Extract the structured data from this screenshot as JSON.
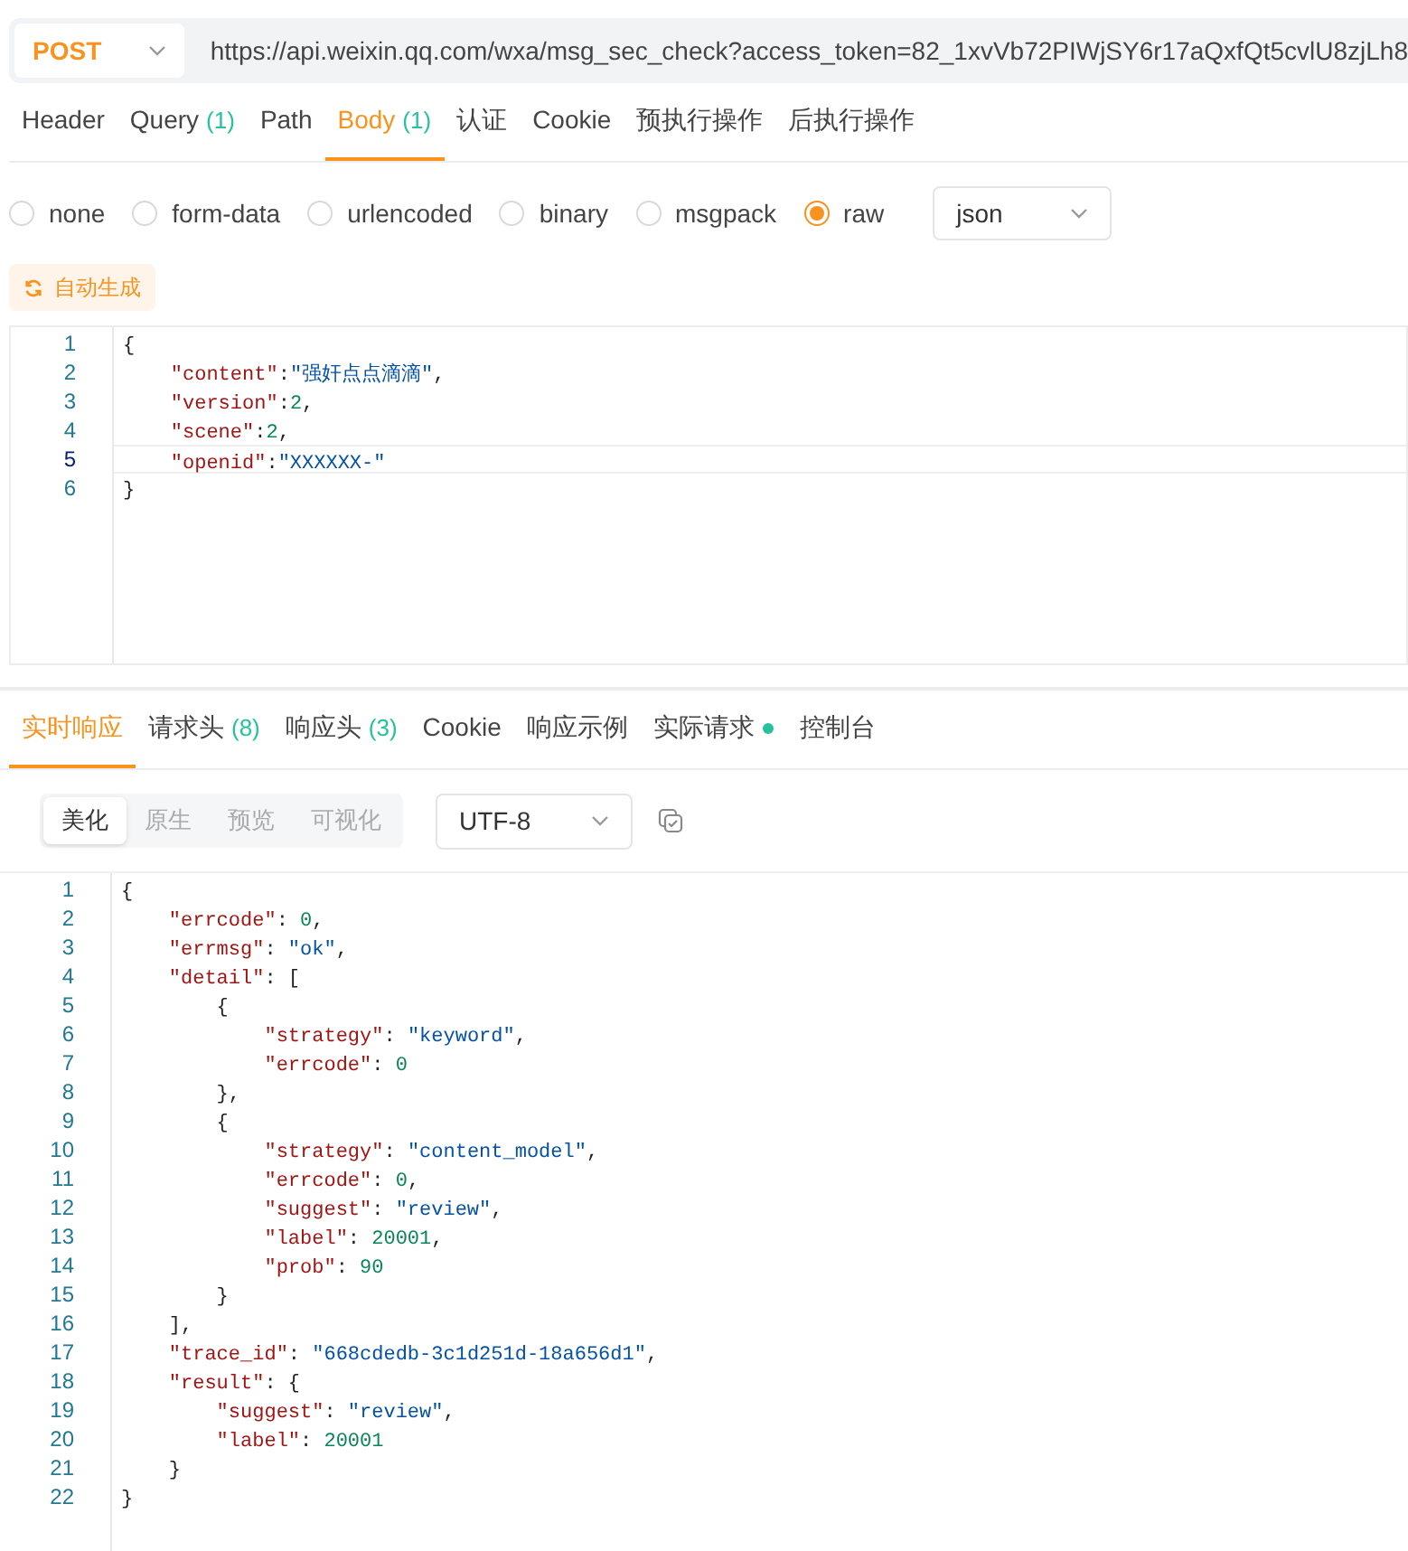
{
  "request": {
    "method": "POST",
    "url": "https://api.weixin.qq.com/wxa/msg_sec_check?access_token=82_1xvVb72PIWjSY6r17aQxfQt5cvlU8zjLh8"
  },
  "request_tabs": [
    {
      "label": "Header",
      "selected": false
    },
    {
      "label": "Query",
      "count": "(1)",
      "selected": false
    },
    {
      "label": "Path",
      "selected": false
    },
    {
      "label": "Body",
      "count": "(1)",
      "selected": true
    },
    {
      "label": "认证",
      "selected": false
    },
    {
      "label": "Cookie",
      "selected": false
    },
    {
      "label": "预执行操作",
      "selected": false
    },
    {
      "label": "后执行操作",
      "selected": false
    }
  ],
  "body_types": [
    {
      "label": "none",
      "selected": false
    },
    {
      "label": "form-data",
      "selected": false
    },
    {
      "label": "urlencoded",
      "selected": false
    },
    {
      "label": "binary",
      "selected": false
    },
    {
      "label": "msgpack",
      "selected": false
    },
    {
      "label": "raw",
      "selected": true
    }
  ],
  "format_select": {
    "value": "json"
  },
  "generate_button": {
    "label": "自动生成"
  },
  "request_body": [
    {
      "number": "1",
      "current": false,
      "tokens": [
        {
          "kind": "p",
          "text": "{"
        }
      ]
    },
    {
      "number": "2",
      "current": false,
      "tokens": [
        {
          "kind": "k",
          "text": "    \"content\""
        },
        {
          "kind": "p",
          "text": ":"
        },
        {
          "kind": "s",
          "text": "\"强奸点点滴滴\""
        },
        {
          "kind": "p",
          "text": ","
        }
      ]
    },
    {
      "number": "3",
      "current": false,
      "tokens": [
        {
          "kind": "k",
          "text": "    \"version\""
        },
        {
          "kind": "p",
          "text": ":"
        },
        {
          "kind": "n",
          "text": "2"
        },
        {
          "kind": "p",
          "text": ","
        }
      ]
    },
    {
      "number": "4",
      "current": false,
      "tokens": [
        {
          "kind": "k",
          "text": "    \"scene\""
        },
        {
          "kind": "p",
          "text": ":"
        },
        {
          "kind": "n",
          "text": "2"
        },
        {
          "kind": "p",
          "text": ","
        }
      ]
    },
    {
      "number": "5",
      "current": true,
      "tokens": [
        {
          "kind": "k",
          "text": "    \"openid\""
        },
        {
          "kind": "p",
          "text": ":"
        },
        {
          "kind": "s",
          "text": "\"XXXXXX-\""
        }
      ]
    },
    {
      "number": "6",
      "current": false,
      "tokens": [
        {
          "kind": "p",
          "text": "}"
        }
      ]
    }
  ],
  "response_tabs": [
    {
      "label": "实时响应",
      "selected": true,
      "indicator": false
    },
    {
      "label": "请求头",
      "count": "(8)",
      "selected": false,
      "indicator": false
    },
    {
      "label": "响应头",
      "count": "(3)",
      "selected": false,
      "indicator": false
    },
    {
      "label": "Cookie",
      "selected": false,
      "indicator": false
    },
    {
      "label": "响应示例",
      "selected": false,
      "indicator": false
    },
    {
      "label": "实际请求",
      "selected": false,
      "indicator": true
    },
    {
      "label": "控制台",
      "selected": false,
      "indicator": false
    }
  ],
  "view_modes": [
    {
      "label": "美化",
      "selected": true
    },
    {
      "label": "原生",
      "selected": false
    },
    {
      "label": "预览",
      "selected": false
    },
    {
      "label": "可视化",
      "selected": false
    }
  ],
  "encoding_select": {
    "value": "UTF-8"
  },
  "response_body": [
    {
      "number": "1",
      "tokens": [
        {
          "kind": "p",
          "text": "{"
        }
      ]
    },
    {
      "number": "2",
      "tokens": [
        {
          "kind": "k",
          "text": "    \"errcode\""
        },
        {
          "kind": "p",
          "text": ": "
        },
        {
          "kind": "n",
          "text": "0"
        },
        {
          "kind": "p",
          "text": ","
        }
      ]
    },
    {
      "number": "3",
      "tokens": [
        {
          "kind": "k",
          "text": "    \"errmsg\""
        },
        {
          "kind": "p",
          "text": ": "
        },
        {
          "kind": "s",
          "text": "\"ok\""
        },
        {
          "kind": "p",
          "text": ","
        }
      ]
    },
    {
      "number": "4",
      "tokens": [
        {
          "kind": "k",
          "text": "    \"detail\""
        },
        {
          "kind": "p",
          "text": ": ["
        }
      ]
    },
    {
      "number": "5",
      "tokens": [
        {
          "kind": "p",
          "text": "        {"
        }
      ]
    },
    {
      "number": "6",
      "tokens": [
        {
          "kind": "k",
          "text": "            \"strategy\""
        },
        {
          "kind": "p",
          "text": ": "
        },
        {
          "kind": "s",
          "text": "\"keyword\""
        },
        {
          "kind": "p",
          "text": ","
        }
      ]
    },
    {
      "number": "7",
      "tokens": [
        {
          "kind": "k",
          "text": "            \"errcode\""
        },
        {
          "kind": "p",
          "text": ": "
        },
        {
          "kind": "n",
          "text": "0"
        }
      ]
    },
    {
      "number": "8",
      "tokens": [
        {
          "kind": "p",
          "text": "        },"
        }
      ]
    },
    {
      "number": "9",
      "tokens": [
        {
          "kind": "p",
          "text": "        {"
        }
      ]
    },
    {
      "number": "10",
      "tokens": [
        {
          "kind": "k",
          "text": "            \"strategy\""
        },
        {
          "kind": "p",
          "text": ": "
        },
        {
          "kind": "s",
          "text": "\"content_model\""
        },
        {
          "kind": "p",
          "text": ","
        }
      ]
    },
    {
      "number": "11",
      "tokens": [
        {
          "kind": "k",
          "text": "            \"errcode\""
        },
        {
          "kind": "p",
          "text": ": "
        },
        {
          "kind": "n",
          "text": "0"
        },
        {
          "kind": "p",
          "text": ","
        }
      ]
    },
    {
      "number": "12",
      "tokens": [
        {
          "kind": "k",
          "text": "            \"suggest\""
        },
        {
          "kind": "p",
          "text": ": "
        },
        {
          "kind": "s",
          "text": "\"review\""
        },
        {
          "kind": "p",
          "text": ","
        }
      ]
    },
    {
      "number": "13",
      "tokens": [
        {
          "kind": "k",
          "text": "            \"label\""
        },
        {
          "kind": "p",
          "text": ": "
        },
        {
          "kind": "n",
          "text": "20001"
        },
        {
          "kind": "p",
          "text": ","
        }
      ]
    },
    {
      "number": "14",
      "tokens": [
        {
          "kind": "k",
          "text": "            \"prob\""
        },
        {
          "kind": "p",
          "text": ": "
        },
        {
          "kind": "n",
          "text": "90"
        }
      ]
    },
    {
      "number": "15",
      "tokens": [
        {
          "kind": "p",
          "text": "        }"
        }
      ]
    },
    {
      "number": "16",
      "tokens": [
        {
          "kind": "p",
          "text": "    ],"
        }
      ]
    },
    {
      "number": "17",
      "tokens": [
        {
          "kind": "k",
          "text": "    \"trace_id\""
        },
        {
          "kind": "p",
          "text": ": "
        },
        {
          "kind": "s",
          "text": "\"668cdedb-3c1d251d-18a656d1\""
        },
        {
          "kind": "p",
          "text": ","
        }
      ]
    },
    {
      "number": "18",
      "tokens": [
        {
          "kind": "k",
          "text": "    \"result\""
        },
        {
          "kind": "p",
          "text": ": {"
        }
      ]
    },
    {
      "number": "19",
      "tokens": [
        {
          "kind": "k",
          "text": "        \"suggest\""
        },
        {
          "kind": "p",
          "text": ": "
        },
        {
          "kind": "s",
          "text": "\"review\""
        },
        {
          "kind": "p",
          "text": ","
        }
      ]
    },
    {
      "number": "20",
      "tokens": [
        {
          "kind": "k",
          "text": "        \"label\""
        },
        {
          "kind": "p",
          "text": ": "
        },
        {
          "kind": "n",
          "text": "20001"
        }
      ]
    },
    {
      "number": "21",
      "tokens": [
        {
          "kind": "p",
          "text": "    }"
        }
      ]
    },
    {
      "number": "22",
      "tokens": [
        {
          "kind": "p",
          "text": "}"
        }
      ]
    }
  ]
}
